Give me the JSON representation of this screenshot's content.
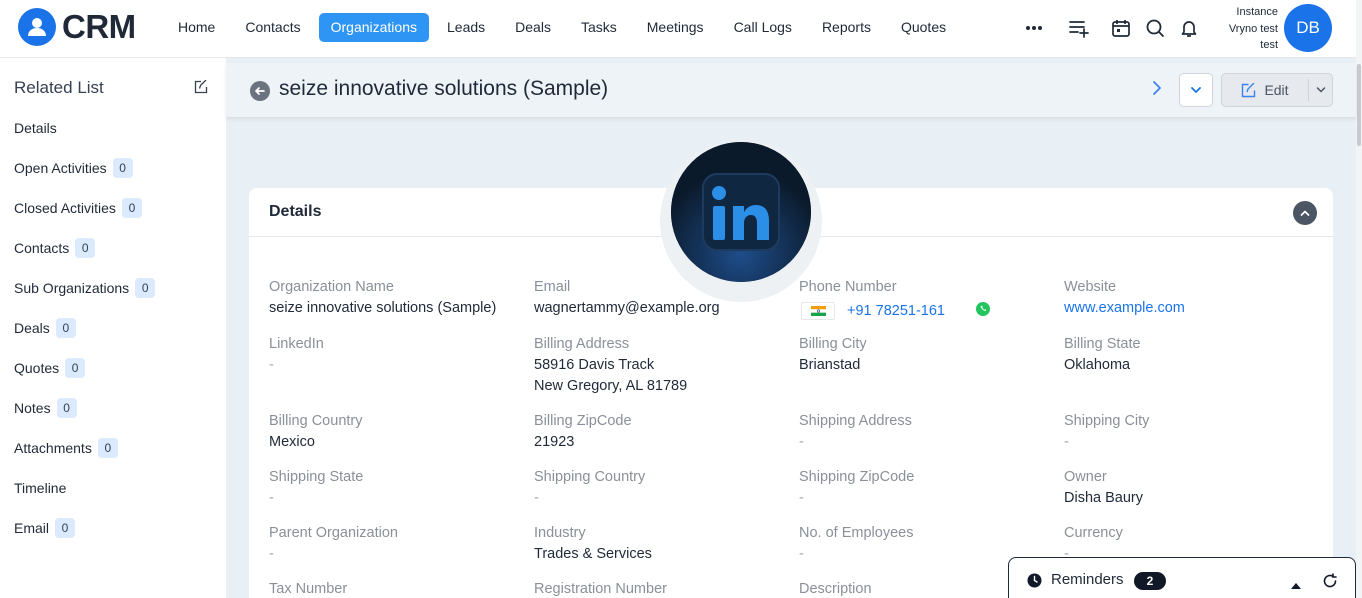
{
  "app": {
    "name": "CRM"
  },
  "nav": {
    "items": [
      {
        "label": "Home"
      },
      {
        "label": "Contacts"
      },
      {
        "label": "Organizations",
        "active": true
      },
      {
        "label": "Leads"
      },
      {
        "label": "Deals"
      },
      {
        "label": "Tasks"
      },
      {
        "label": "Meetings"
      },
      {
        "label": "Call Logs"
      },
      {
        "label": "Reports"
      },
      {
        "label": "Quotes"
      }
    ],
    "icons": [
      "more-icon",
      "add-list-icon",
      "calendar-icon",
      "search-icon",
      "bell-icon"
    ]
  },
  "user": {
    "instance_line1": "Instance",
    "instance_line2": "Vryno test",
    "instance_line3": "test",
    "initials": "DB"
  },
  "sidebar": {
    "title": "Related List",
    "items": [
      {
        "label": "Details",
        "count": null
      },
      {
        "label": "Open Activities",
        "count": "0"
      },
      {
        "label": "Closed Activities",
        "count": "0"
      },
      {
        "label": "Contacts",
        "count": "0"
      },
      {
        "label": "Sub Organizations",
        "count": "0"
      },
      {
        "label": "Deals",
        "count": "0"
      },
      {
        "label": "Quotes",
        "count": "0"
      },
      {
        "label": "Notes",
        "count": "0"
      },
      {
        "label": "Attachments",
        "count": "0"
      },
      {
        "label": "Timeline",
        "count": null
      },
      {
        "label": "Email",
        "count": "0"
      }
    ]
  },
  "record": {
    "title": "seize innovative solutions (Sample)",
    "edit_label": "Edit"
  },
  "details": {
    "title": "Details",
    "fields": {
      "org_name": {
        "label": "Organization Name",
        "value": "seize innovative solutions (Sample)"
      },
      "email": {
        "label": "Email",
        "value": "wagnertammy@example.org"
      },
      "phone": {
        "label": "Phone Number",
        "value": "+91 78251-161"
      },
      "website": {
        "label": "Website",
        "value": "www.example.com"
      },
      "linkedin": {
        "label": "LinkedIn",
        "value": "-"
      },
      "billing_address": {
        "label": "Billing Address",
        "line1": "58916 Davis Track",
        "line2": "New Gregory, AL 81789"
      },
      "billing_city": {
        "label": "Billing City",
        "value": "Brianstad"
      },
      "billing_state": {
        "label": "Billing State",
        "value": "Oklahoma"
      },
      "billing_country": {
        "label": "Billing Country",
        "value": "Mexico"
      },
      "billing_zip": {
        "label": "Billing ZipCode",
        "value": "21923"
      },
      "shipping_address": {
        "label": "Shipping Address",
        "value": "-"
      },
      "shipping_city": {
        "label": "Shipping City",
        "value": "-"
      },
      "shipping_state": {
        "label": "Shipping State",
        "value": "-"
      },
      "shipping_country": {
        "label": "Shipping Country",
        "value": "-"
      },
      "shipping_zip": {
        "label": "Shipping ZipCode",
        "value": "-"
      },
      "owner": {
        "label": "Owner",
        "value": "Disha Baury"
      },
      "parent_org": {
        "label": "Parent Organization",
        "value": "-"
      },
      "industry": {
        "label": "Industry",
        "value": "Trades & Services"
      },
      "employees": {
        "label": "No. of Employees",
        "value": "-"
      },
      "currency": {
        "label": "Currency",
        "value": "-"
      },
      "tax_number": {
        "label": "Tax Number"
      },
      "registration_number": {
        "label": "Registration Number"
      },
      "description": {
        "label": "Description"
      }
    }
  },
  "reminders": {
    "label": "Reminders",
    "count": "2"
  },
  "colors": {
    "primary": "#1a73e8",
    "active_nav": "#2f95f5",
    "page_bg": "#e8eff5"
  }
}
